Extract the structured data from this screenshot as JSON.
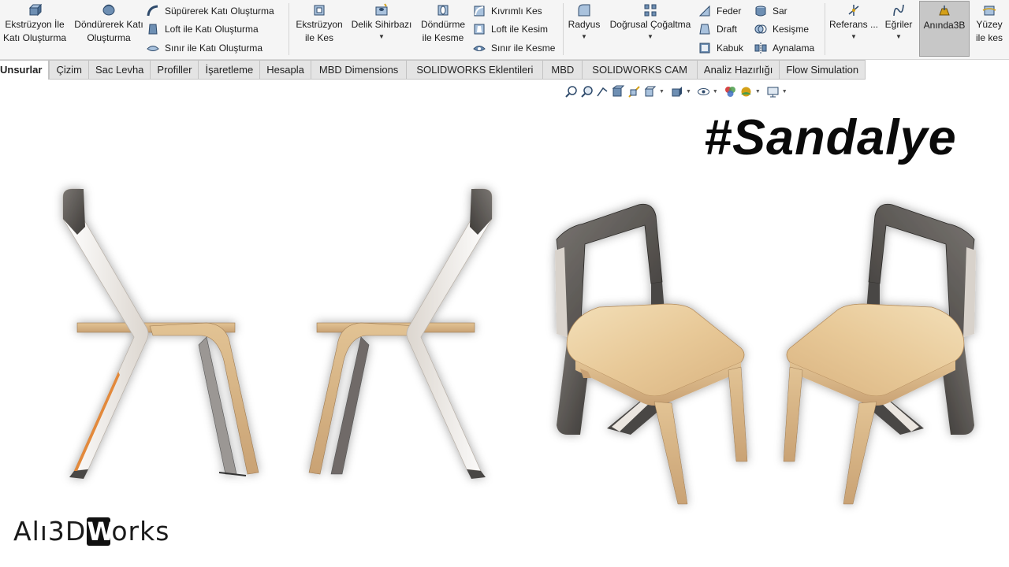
{
  "ribbon": {
    "extrude_boss": "Ekstrüzyon İle Katı Oluşturma",
    "revolve_boss": "Döndürerek Katı Oluşturma",
    "swept_boss": "Süpürerek Katı Oluşturma",
    "loft_boss": "Loft ile Katı Oluşturma",
    "boundary_boss": "Sınır ile Katı Oluşturma",
    "extrude_cut": "Ekstrüzyon ile Kes",
    "hole_wizard": "Delik Sihirbazı",
    "revolve_cut": "Döndürme ile Kesme",
    "swept_cut": "Kıvrımlı Kes",
    "loft_cut": "Loft ile Kesim",
    "boundary_cut": "Sınır ile Kesme",
    "fillet": "Radyus",
    "linear_pattern": "Doğrusal Çoğaltma",
    "rib": "Feder",
    "draft": "Draft",
    "shell": "Kabuk",
    "wrap": "Sar",
    "intersect": "Kesişme",
    "mirror": "Aynalama",
    "reference": "Referans ...",
    "curves": "Eğriler",
    "instant3d": "Anında3B",
    "surface": "Yüzey ile kes"
  },
  "tabs": [
    "Unsurlar",
    "Çizim",
    "Sac Levha",
    "Profiller",
    "İşaretleme",
    "Hesapla",
    "MBD Dimensions",
    "SOLIDWORKS Eklentileri",
    "MBD",
    "SOLIDWORKS CAM",
    "Analiz Hazırlığı",
    "Flow Simulation"
  ],
  "title": "#Sandalye",
  "logo": {
    "pre": "Alı3D",
    "mark": "W",
    "post": "orks"
  },
  "colors": {
    "ribbon_bg": "#f5f5f5",
    "tab_bg": "#e4e4e4",
    "wood": "#e9cfa3",
    "frame_light": "#ebe6e0",
    "frame_dark": "#4a4744"
  }
}
